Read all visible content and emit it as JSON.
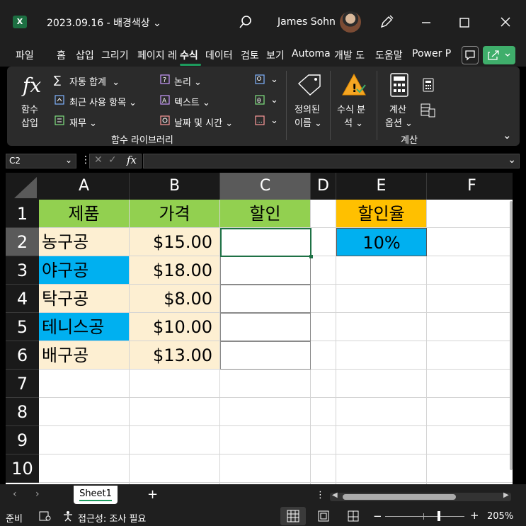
{
  "window": {
    "title": "2023.09.16 - 배경색상",
    "user_name": "James Sohn"
  },
  "menu_tabs": [
    "파일",
    "홈",
    "삽입",
    "그리기",
    "페이지 레",
    "수식",
    "데이터",
    "검토",
    "보기",
    "Automa",
    "개발 도",
    "도움말",
    "Power P"
  ],
  "active_tab": "수식",
  "ribbon": {
    "insert_function": [
      "함수",
      "삽입"
    ],
    "autosum": "자동 합계",
    "recent": "최근 사용 항목",
    "financial": "재무",
    "logical": "논리",
    "text": "텍스트",
    "datetime": "날짜 및 시간",
    "defined_names": [
      "정의된",
      "이름"
    ],
    "formula_auditing": [
      "수식 분",
      "석"
    ],
    "calc_options": [
      "계산",
      "옵션"
    ],
    "group_library": "함수 라이브러리",
    "group_calc": "계산"
  },
  "formula_bar": {
    "name_box": "C2",
    "formula": ""
  },
  "grid": {
    "columns": [
      "A",
      "B",
      "C",
      "D",
      "E",
      "F"
    ],
    "selected_column": "C",
    "rows": [
      "1",
      "2",
      "3",
      "4",
      "5",
      "6",
      "7",
      "8",
      "9",
      "10"
    ],
    "selected_row": "2",
    "headers": {
      "product": "제품",
      "price": "가격",
      "discount": "할인",
      "rate_label": "할인율"
    },
    "rate_value": "10%",
    "products": [
      {
        "name": "농구공",
        "price": "$15.00"
      },
      {
        "name": "야구공",
        "price": "$18.00"
      },
      {
        "name": "탁구공",
        "price": "$8.00"
      },
      {
        "name": "테니스공",
        "price": "$10.00"
      },
      {
        "name": "배구공",
        "price": "$13.00"
      }
    ]
  },
  "colors": {
    "header_green": "#92d050",
    "rate_orange": "#ffc000",
    "rate_blue": "#00b0f0",
    "cell_cream": "#fdefd2",
    "cell_blue": "#00b0f0"
  },
  "sheet_tab": "Sheet1",
  "status": {
    "ready": "준비",
    "accessibility": "접근성: 조사 필요",
    "zoom": "205%"
  }
}
